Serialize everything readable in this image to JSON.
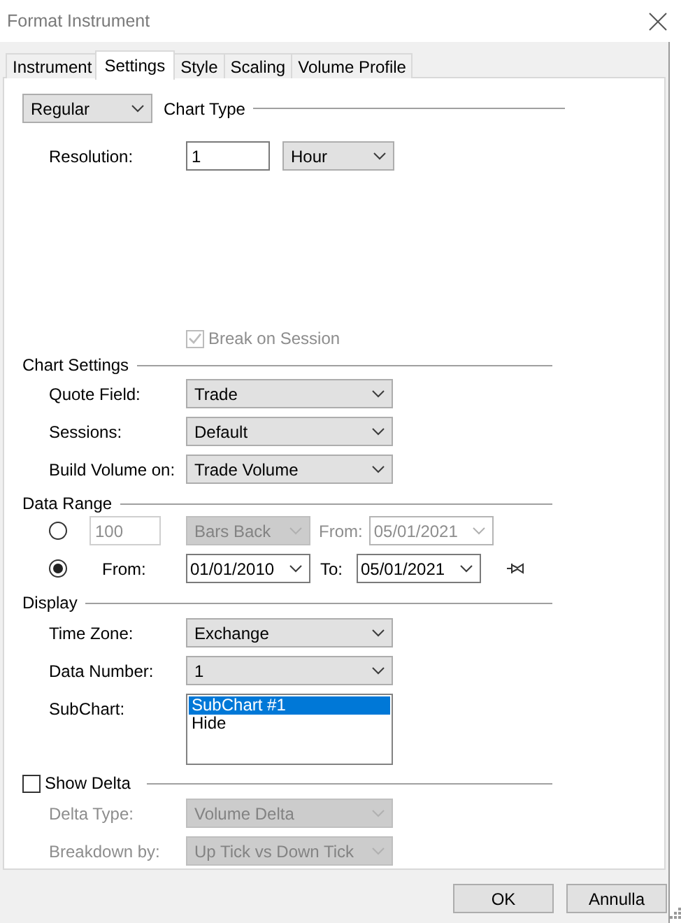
{
  "window": {
    "title": "Format Instrument"
  },
  "tabs": [
    {
      "label": "Instrument",
      "selected": false
    },
    {
      "label": "Settings",
      "selected": true
    },
    {
      "label": "Style",
      "selected": false
    },
    {
      "label": "Scaling",
      "selected": false
    },
    {
      "label": "Volume Profile",
      "selected": false
    }
  ],
  "chart_type": {
    "value": "Regular",
    "heading": "Chart Type"
  },
  "resolution": {
    "label": "Resolution:",
    "value": "1",
    "unit": "Hour"
  },
  "break_on_session": {
    "label": "Break on Session",
    "checked": true,
    "disabled": true
  },
  "chart_settings": {
    "heading": "Chart Settings",
    "fields": [
      {
        "label": "Quote Field:",
        "value": "Trade"
      },
      {
        "label": "Sessions:",
        "value": "Default"
      },
      {
        "label": "Build Volume on:",
        "value": "Trade Volume"
      }
    ]
  },
  "data_range": {
    "heading": "Data Range",
    "options": [
      {
        "kind": "bars_back",
        "selected": false,
        "disabled": true,
        "count": "100",
        "mode": "Bars Back",
        "from_label": "From:",
        "from": "05/01/2021"
      },
      {
        "kind": "dates",
        "selected": true,
        "disabled": false,
        "from_label": "From:",
        "from": "01/01/2010",
        "to_label": "To:",
        "to": "05/01/2021"
      }
    ]
  },
  "display": {
    "heading": "Display",
    "fields": [
      {
        "label": "Time Zone:",
        "value": "Exchange"
      },
      {
        "label": "Data Number:",
        "value": "1"
      }
    ],
    "subchart": {
      "label": "SubChart:",
      "items": [
        {
          "label": "SubChart #1",
          "selected": true
        },
        {
          "label": "Hide",
          "selected": false
        }
      ]
    }
  },
  "show_delta": {
    "label": "Show Delta",
    "checked": false,
    "fields": [
      {
        "label": "Delta Type:",
        "value": "Volume Delta",
        "disabled": true
      },
      {
        "label": "Breakdown by:",
        "value": "Up Tick vs Down Tick",
        "disabled": true
      }
    ]
  },
  "buttons": [
    {
      "label": "OK"
    },
    {
      "label": "Annulla"
    }
  ]
}
